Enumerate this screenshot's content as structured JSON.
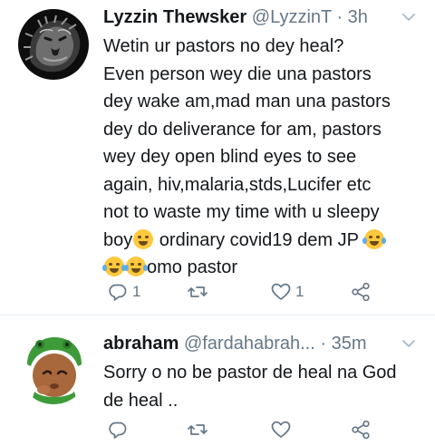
{
  "tweets": [
    {
      "display_name": "Lyzzin Thewsker",
      "handle": "@LyzzinT",
      "separator": "·",
      "time": "3h",
      "text_part1": "Wetin ur pastors no dey heal?\nEven person wey die una pastors\ndey wake am,mad man una pastors\ndey do deliverance for am, pastors\nwey dey open blind eyes to see\nagain, hiv,malaria,stds,Lucifer etc\nnot to waste my time with u sleepy\nboy",
      "text_part2": " ordinary covid19 dem JP ",
      "text_part3": "omo pastor",
      "emojis": [
        "smirking-face",
        "face-with-tears-of-joy",
        "face-with-tears-of-joy",
        "face-with-tears-of-joy"
      ],
      "reply_count": "1",
      "retweet_count": "",
      "like_count": "1"
    },
    {
      "display_name": "abraham",
      "handle": "@fardahabrah...",
      "separator": "·",
      "time": "35m",
      "text": "Sorry o no be pastor de heal na God\nde heal ..",
      "reply_count": "",
      "retweet_count": "",
      "like_count": ""
    }
  ],
  "icons": {
    "more": "chevron-down-icon",
    "reply": "reply-icon",
    "retweet": "retweet-icon",
    "like": "heart-icon",
    "share": "share-icon"
  },
  "colors": {
    "text": "#14171a",
    "secondary": "#657786",
    "divider": "#e6ecf0",
    "emoji": "#ffc83d"
  }
}
